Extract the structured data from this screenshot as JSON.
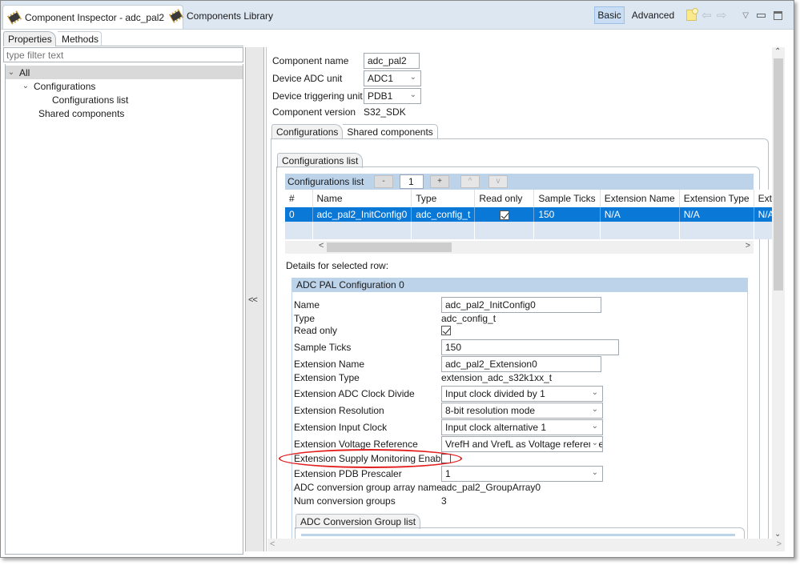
{
  "tabs": {
    "inspector": "Component Inspector - adc_pal2",
    "library": "Components Library"
  },
  "toolbar": {
    "basic": "Basic",
    "advanced": "Advanced",
    "back_icon": "⇦",
    "forward_icon": "⇨",
    "menu_icon": "▽"
  },
  "left": {
    "tabs": [
      "Properties",
      "Methods"
    ],
    "filter_placeholder": "type filter text",
    "tree": [
      {
        "label": "All",
        "expanded": true
      },
      {
        "label": "Configurations",
        "expanded": true
      },
      {
        "label": "Configurations list"
      },
      {
        "label": "Shared components"
      }
    ],
    "collapse_label": "<<"
  },
  "component": {
    "name_label": "Component name",
    "name_value": "adc_pal2",
    "adc_unit_label": "Device ADC unit",
    "adc_unit_value": "ADC1",
    "trigger_label": "Device triggering unit",
    "trigger_value": "PDB1",
    "version_label": "Component version",
    "version_value": "S32_SDK"
  },
  "outer_tabs": [
    "Configurations",
    "Shared components"
  ],
  "inner_tab": "Configurations list",
  "config_list": {
    "title": "Configurations list",
    "minus": "-",
    "count": "1",
    "plus": "+",
    "up": "^",
    "down": "v",
    "columns": [
      "#",
      "Name",
      "Type",
      "Read only",
      "Sample Ticks",
      "Extension Name",
      "Extension Type",
      "Extens"
    ],
    "rows": [
      {
        "num": "0",
        "name": "adc_pal2_InitConfig0",
        "type": "adc_config_t",
        "read_only": true,
        "sample_ticks": "150",
        "ext_name": "N/A",
        "ext_type": "N/A",
        "ext_more": "N/A"
      }
    ],
    "scroll_left": "<",
    "scroll_right": ">"
  },
  "details": {
    "caption": "Details for selected row:",
    "group_title": "ADC PAL Configuration 0",
    "name_label": "Name",
    "name_value": "adc_pal2_InitConfig0",
    "type_label": "Type",
    "type_value": "adc_config_t",
    "readonly_label": "Read only",
    "readonly_checked": true,
    "ticks_label": "Sample Ticks",
    "ticks_value": "150",
    "ext_name_label": "Extension Name",
    "ext_name_value": "adc_pal2_Extension0",
    "ext_type_label": "Extension Type",
    "ext_type_value": "extension_adc_s32k1xx_t",
    "clock_div_label": "Extension ADC Clock Divide",
    "clock_div_value": "Input clock divided by 1",
    "resolution_label": "Extension Resolution",
    "resolution_value": "8-bit resolution mode",
    "input_clock_label": "Extension Input Clock",
    "input_clock_value": "Input clock alternative 1",
    "vref_label": "Extension Voltage Reference",
    "vref_value": "VrefH and VrefL as Voltage reference.",
    "supply_label": "Extension Supply Monitoring Enable",
    "supply_checked": false,
    "pdb_label": "Extension PDB Prescaler",
    "pdb_value": "1",
    "group_array_label": "ADC conversion group array name",
    "group_array_value": "adc_pal2_GroupArray0",
    "num_groups_label": "Num conversion groups",
    "num_groups_value": "3",
    "conv_group_tab": "ADC Conversion Group list"
  },
  "colors": {
    "selection": "#0a78d7",
    "header_band": "#bcd3ea",
    "highlight": "#e32020"
  }
}
